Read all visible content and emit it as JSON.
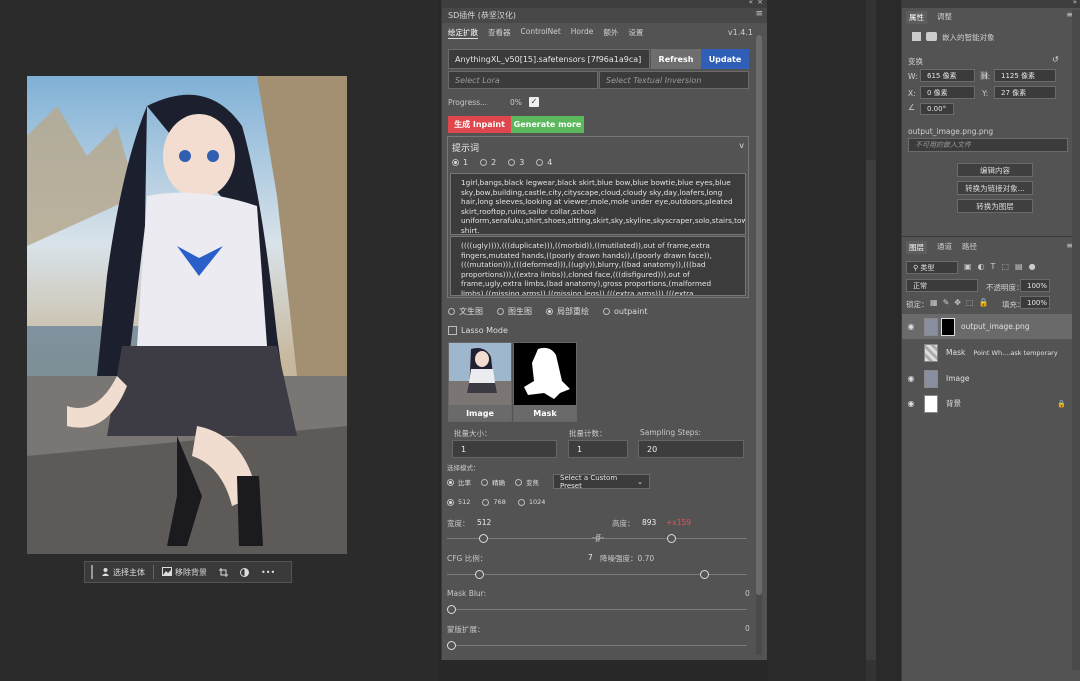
{
  "canvas": {
    "context_toolbar": {
      "select_subject": "选择主体",
      "remove_background": "移除背景"
    }
  },
  "plugin": {
    "title": "SD插件 (恭坚汉化)",
    "tabs": [
      "绘定扩散",
      "查看器",
      "ControlNet",
      "Horde",
      "额外",
      "设置"
    ],
    "version": "v1.4.1",
    "model": "AnythingXL_v50[15].safetensors [7f96a1a9ca]",
    "refresh_label": "Refresh",
    "update_label": "Update",
    "lora_placeholder": "Select Lora",
    "textual_inversion_placeholder": "Select Textual Inversion",
    "progress_label": "Progress...",
    "progress_value": "0%",
    "generate_inpaint_label": "生成 Inpaint",
    "generate_more_label": "Generate more",
    "prompt_header": "提示词",
    "prompt_slots": [
      "1",
      "2",
      "3",
      "4"
    ],
    "positive_prompt": "1girl,bangs,black legwear,black skirt,blue bow,blue bowtie,blue eyes,blue sky,bow,building,castle,city,cityscape,cloud,cloudy sky,day,loafers,long hair,long sleeves,looking at viewer,mole,mole under eye,outdoors,pleated skirt,rooftop,ruins,sailor collar,school uniform,serafuku,shirt,shoes,sitting,skirt,sky,skyline,skyscraper,solo,stairs,tower,town,white shirt.",
    "negative_prompt": "((((ugly)))),(((duplicate))),((morbid)),((mutilated)),out of frame,extra fingers,mutated hands,((poorly drawn hands)),((poorly drawn face)),(((mutation))),(((deformed))),((ugly)),blurry,((bad anatomy)),(((bad proportions))),((extra limbs)),cloned face,(((disfigured))),out of frame,ugly,extra limbs,(bad anatomy),gross proportions,(malformed limbs),((missing arms)),((missing legs)),(((extra arms))),(((extra legs))),mutated hands,(fused fingers),(too",
    "modes": [
      "文生图",
      "图生图",
      "局部重绘",
      "outpaint"
    ],
    "lasso_label": "Lasso Mode",
    "image_label": "Image",
    "mask_label": "Mask",
    "batch_size_label": "批量大小：",
    "batch_size": "1",
    "batch_count_label": "批量计数：",
    "batch_count": "1",
    "steps_label": "Sampling Steps:",
    "steps": "20",
    "select_mode_label": "选择模式：",
    "ratio_options": [
      "比率",
      "精确",
      "变焦"
    ],
    "preset_label": "Select a Custom Preset",
    "size_options": [
      "512",
      "768",
      "1024"
    ],
    "width_label": "宽度：",
    "width_value": "512",
    "height_label": "高度：",
    "height_value": "893",
    "height_extra": "+x159",
    "cfg_label": "CFG 比例：",
    "cfg_value": "7",
    "denoise_label": "降噪强度：0.70",
    "mask_blur_label": "Mask Blur:",
    "mask_blur_value": "0",
    "mask_expand_label": "蒙版扩展：",
    "mask_expand_value": "0"
  },
  "right_panel": {
    "tabs": [
      "属性",
      "调整"
    ],
    "embedded_object": "嵌入的智能对象",
    "transform_label": "变换",
    "w_label": "W:",
    "w_value": "615 像素",
    "h_label": "H:",
    "h_value": "1125 像素",
    "x_label": "X:",
    "x_value": "0 像素",
    "y_label": "Y:",
    "y_value": "27 像素",
    "angle_value": "0.00°",
    "file_name": "output_image.png.png",
    "file_field": "不可用的嵌入文件",
    "edit_contents": "编辑内容",
    "convert_linked": "转换为链接对象...",
    "convert_layers": "转换为图层",
    "layer_tabs": [
      "图层",
      "通道",
      "路径"
    ],
    "kind_label": "类型",
    "blend_mode": "正常",
    "opacity_label": "不透明度：",
    "opacity_value": "100%",
    "lock_label": "锁定：",
    "fill_label": "填充：",
    "fill_value": "100%",
    "layers": [
      {
        "name": "output_image.png",
        "extra": ""
      },
      {
        "name": "Mask",
        "extra": "Point Wh....ask     temporary"
      },
      {
        "name": "Image",
        "extra": ""
      },
      {
        "name": "背景",
        "extra": ""
      }
    ]
  }
}
